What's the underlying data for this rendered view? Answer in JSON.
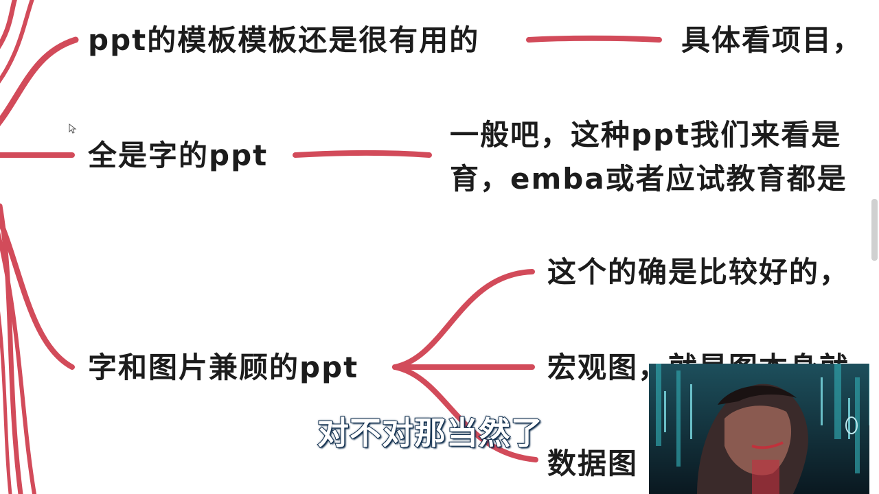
{
  "nodes": {
    "template_useful": "ppt的模板模板还是很有用的",
    "template_detail": "具体看项目，",
    "all_text": "全是字的ppt",
    "all_text_detail_1": "一般吧，这种ppt我们来看是",
    "all_text_detail_2": "育，emba或者应试教育都是",
    "text_image": "字和图片兼顾的ppt",
    "good_one": "这个的确是比较好的，",
    "macro_chart": "宏观图，就是图本身就",
    "data_chart": "数据图"
  },
  "subtitle": "对不对那当然了",
  "colors": {
    "branch": "#d24b5a",
    "text": "#1c1c1c",
    "subtitle_fill": "#ffffff",
    "subtitle_outline": "#0b2a4a"
  },
  "icons": {
    "cursor": "mouse-pointer-icon"
  }
}
